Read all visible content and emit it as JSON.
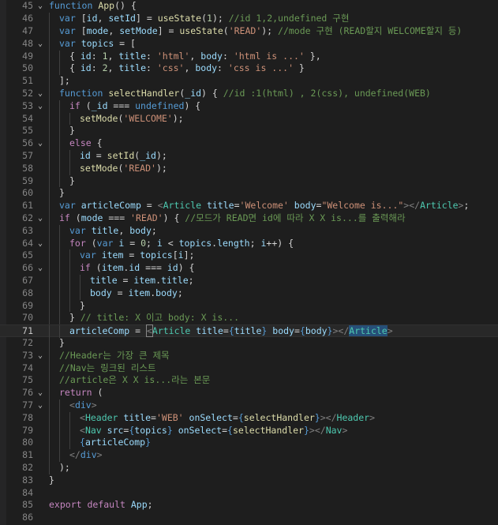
{
  "editor": {
    "lines": [
      {
        "n": "45",
        "fold": "⌄",
        "t": [
          [
            "kw",
            "function "
          ],
          [
            "fn",
            "App"
          ],
          [
            "pu",
            "() {"
          ]
        ]
      },
      {
        "n": "46",
        "t": [
          [
            "kw",
            "var "
          ],
          [
            "pu",
            "["
          ],
          [
            "vr",
            "id"
          ],
          [
            "pu",
            ", "
          ],
          [
            "vr",
            "setId"
          ],
          [
            "pu",
            "] = "
          ],
          [
            "fn",
            "useState"
          ],
          [
            "pu",
            "("
          ],
          [
            "num",
            "1"
          ],
          [
            "pu",
            "); "
          ],
          [
            "cm",
            "//id 1,2,undefined 구현"
          ]
        ]
      },
      {
        "n": "47",
        "t": [
          [
            "kw",
            "var "
          ],
          [
            "pu",
            "["
          ],
          [
            "vr",
            "mode"
          ],
          [
            "pu",
            ", "
          ],
          [
            "vr",
            "setMode"
          ],
          [
            "pu",
            "] = "
          ],
          [
            "fn",
            "useState"
          ],
          [
            "pu",
            "("
          ],
          [
            "str",
            "'READ'"
          ],
          [
            "pu",
            "); "
          ],
          [
            "cm",
            "//mode 구현 (READ할지 WELCOME할지 등)"
          ]
        ]
      },
      {
        "n": "48",
        "fold": "⌄",
        "t": [
          [
            "kw",
            "var "
          ],
          [
            "vr",
            "topics"
          ],
          [
            "pu",
            " = ["
          ]
        ]
      },
      {
        "n": "49",
        "t": [
          [
            "pu",
            "{ "
          ],
          [
            "vr",
            "id"
          ],
          [
            "pu",
            ": "
          ],
          [
            "num",
            "1"
          ],
          [
            "pu",
            ", "
          ],
          [
            "vr",
            "title"
          ],
          [
            "pu",
            ": "
          ],
          [
            "str",
            "'html'"
          ],
          [
            "pu",
            ", "
          ],
          [
            "vr",
            "body"
          ],
          [
            "pu",
            ": "
          ],
          [
            "str",
            "'html is ...'"
          ],
          [
            "pu",
            " },"
          ]
        ]
      },
      {
        "n": "50",
        "t": [
          [
            "pu",
            "{ "
          ],
          [
            "vr",
            "id"
          ],
          [
            "pu",
            ": "
          ],
          [
            "num",
            "2"
          ],
          [
            "pu",
            ", "
          ],
          [
            "vr",
            "title"
          ],
          [
            "pu",
            ": "
          ],
          [
            "str",
            "'css'"
          ],
          [
            "pu",
            ", "
          ],
          [
            "vr",
            "body"
          ],
          [
            "pu",
            ": "
          ],
          [
            "str",
            "'css is ...'"
          ],
          [
            "pu",
            " }"
          ]
        ]
      },
      {
        "n": "51",
        "t": [
          [
            "pu",
            "];"
          ]
        ]
      },
      {
        "n": "52",
        "fold": "⌄",
        "t": [
          [
            "kw",
            "function "
          ],
          [
            "fn",
            "selectHandler"
          ],
          [
            "pu",
            "("
          ],
          [
            "vr",
            "_id"
          ],
          [
            "pu",
            ") { "
          ],
          [
            "cm",
            "//id :1(html) , 2(css), undefined(WEB)"
          ]
        ]
      },
      {
        "n": "53",
        "fold": "⌄",
        "t": [
          [
            "ctl",
            "if "
          ],
          [
            "pu",
            "("
          ],
          [
            "vr",
            "_id"
          ],
          [
            "pu",
            " === "
          ],
          [
            "kw",
            "undefined"
          ],
          [
            "pu",
            ") {"
          ]
        ]
      },
      {
        "n": "54",
        "t": [
          [
            "fn",
            "setMode"
          ],
          [
            "pu",
            "("
          ],
          [
            "str",
            "'WELCOME'"
          ],
          [
            "pu",
            ");"
          ]
        ]
      },
      {
        "n": "55",
        "t": [
          [
            "pu",
            "}"
          ]
        ]
      },
      {
        "n": "56",
        "fold": "⌄",
        "t": [
          [
            "ctl",
            "else "
          ],
          [
            "pu",
            "{"
          ]
        ]
      },
      {
        "n": "57",
        "t": [
          [
            "vr",
            "id"
          ],
          [
            "pu",
            " = "
          ],
          [
            "fn",
            "setId"
          ],
          [
            "pu",
            "("
          ],
          [
            "vr",
            "_id"
          ],
          [
            "pu",
            ");"
          ]
        ]
      },
      {
        "n": "58",
        "t": [
          [
            "fn",
            "setMode"
          ],
          [
            "pu",
            "("
          ],
          [
            "str",
            "'READ'"
          ],
          [
            "pu",
            ");"
          ]
        ]
      },
      {
        "n": "59",
        "t": [
          [
            "pu",
            "}"
          ]
        ]
      },
      {
        "n": "60",
        "t": [
          [
            "pu",
            "}"
          ]
        ]
      },
      {
        "n": "61",
        "t": [
          [
            "kw",
            "var "
          ],
          [
            "vr",
            "articleComp"
          ],
          [
            "pu",
            " = "
          ],
          [
            "br",
            "<"
          ],
          [
            "tag",
            "Article "
          ],
          [
            "attr",
            "title"
          ],
          [
            "pu",
            "="
          ],
          [
            "str",
            "'Welcome' "
          ],
          [
            "attr",
            "body"
          ],
          [
            "pu",
            "="
          ],
          [
            "str",
            "\"Welcome is...\""
          ],
          [
            "br",
            "></"
          ],
          [
            "tag",
            "Article"
          ],
          [
            "br",
            ">"
          ],
          [
            "pu",
            ";"
          ]
        ]
      },
      {
        "n": "62",
        "fold": "⌄",
        "t": [
          [
            "ctl",
            "if "
          ],
          [
            "pu",
            "("
          ],
          [
            "vr",
            "mode"
          ],
          [
            "pu",
            " === "
          ],
          [
            "str",
            "'READ'"
          ],
          [
            "pu",
            ") { "
          ],
          [
            "cm",
            "//모드가 READ면 id에 따라 X X is...를 출력해라"
          ]
        ]
      },
      {
        "n": "63",
        "t": [
          [
            "kw",
            "var "
          ],
          [
            "vr",
            "title"
          ],
          [
            "pu",
            ", "
          ],
          [
            "vr",
            "body"
          ],
          [
            "pu",
            ";"
          ]
        ]
      },
      {
        "n": "64",
        "fold": "⌄",
        "t": [
          [
            "ctl",
            "for "
          ],
          [
            "pu",
            "("
          ],
          [
            "kw",
            "var "
          ],
          [
            "vr",
            "i"
          ],
          [
            "pu",
            " = "
          ],
          [
            "num",
            "0"
          ],
          [
            "pu",
            "; "
          ],
          [
            "vr",
            "i"
          ],
          [
            "pu",
            " < "
          ],
          [
            "vr",
            "topics"
          ],
          [
            "pu",
            "."
          ],
          [
            "vr",
            "length"
          ],
          [
            "pu",
            "; "
          ],
          [
            "vr",
            "i"
          ],
          [
            "pu",
            "++) {"
          ]
        ]
      },
      {
        "n": "65",
        "t": [
          [
            "kw",
            "var "
          ],
          [
            "vr",
            "item"
          ],
          [
            "pu",
            " = "
          ],
          [
            "vr",
            "topics"
          ],
          [
            "pu",
            "["
          ],
          [
            "vr",
            "i"
          ],
          [
            "pu",
            "];"
          ]
        ]
      },
      {
        "n": "66",
        "fold": "⌄",
        "t": [
          [
            "ctl",
            "if "
          ],
          [
            "pu",
            "("
          ],
          [
            "vr",
            "item"
          ],
          [
            "pu",
            "."
          ],
          [
            "vr",
            "id"
          ],
          [
            "pu",
            " === "
          ],
          [
            "vr",
            "id"
          ],
          [
            "pu",
            ") {"
          ]
        ]
      },
      {
        "n": "67",
        "t": [
          [
            "vr",
            "title"
          ],
          [
            "pu",
            " = "
          ],
          [
            "vr",
            "item"
          ],
          [
            "pu",
            "."
          ],
          [
            "vr",
            "title"
          ],
          [
            "pu",
            ";"
          ]
        ]
      },
      {
        "n": "68",
        "t": [
          [
            "vr",
            "body"
          ],
          [
            "pu",
            " = "
          ],
          [
            "vr",
            "item"
          ],
          [
            "pu",
            "."
          ],
          [
            "vr",
            "body"
          ],
          [
            "pu",
            ";"
          ]
        ]
      },
      {
        "n": "69",
        "t": [
          [
            "pu",
            "}"
          ]
        ]
      },
      {
        "n": "70",
        "t": [
          [
            "pu",
            "} "
          ],
          [
            "cm",
            "// title: X 이고 body: X is..."
          ]
        ]
      },
      {
        "n": "71",
        "t": [
          [
            "vr",
            "articleComp"
          ],
          [
            "pu",
            " = "
          ],
          [
            "br",
            "<"
          ],
          [
            "tag",
            "Article"
          ],
          [
            "attr",
            " title"
          ],
          [
            "pu",
            "="
          ],
          [
            "kw",
            "{"
          ],
          [
            "vr",
            "title"
          ],
          [
            "kw",
            "}"
          ],
          [
            "attr",
            " body"
          ],
          [
            "pu",
            "="
          ],
          [
            "kw",
            "{"
          ],
          [
            "vr",
            "body"
          ],
          [
            "kw",
            "}"
          ],
          [
            "br",
            "></"
          ],
          [
            "tag",
            "Article"
          ],
          [
            "br",
            ">"
          ]
        ]
      },
      {
        "n": "72",
        "t": [
          [
            "pu",
            "}"
          ]
        ]
      },
      {
        "n": "73",
        "fold": "⌄",
        "t": [
          [
            "cm",
            "//Header는 가장 큰 제목"
          ]
        ]
      },
      {
        "n": "74",
        "t": [
          [
            "cm",
            "//Nav는 링크된 리스트"
          ]
        ]
      },
      {
        "n": "75",
        "t": [
          [
            "cm",
            "//article은 X X is...라는 본문"
          ]
        ]
      },
      {
        "n": "76",
        "fold": "⌄",
        "t": [
          [
            "ctl",
            "return "
          ],
          [
            "pu",
            "("
          ]
        ]
      },
      {
        "n": "77",
        "fold": "⌄",
        "t": [
          [
            "br",
            "<"
          ],
          [
            "kw",
            "div"
          ],
          [
            "br",
            ">"
          ]
        ]
      },
      {
        "n": "78",
        "t": [
          [
            "br",
            "<"
          ],
          [
            "tag",
            "Header "
          ],
          [
            "attr",
            "title"
          ],
          [
            "pu",
            "="
          ],
          [
            "str",
            "'WEB' "
          ],
          [
            "attr",
            "onSelect"
          ],
          [
            "pu",
            "="
          ],
          [
            "kw",
            "{"
          ],
          [
            "fn",
            "selectHandler"
          ],
          [
            "kw",
            "}"
          ],
          [
            "br",
            "></"
          ],
          [
            "tag",
            "Header"
          ],
          [
            "br",
            ">"
          ]
        ]
      },
      {
        "n": "79",
        "t": [
          [
            "br",
            "<"
          ],
          [
            "tag",
            "Nav "
          ],
          [
            "attr",
            "src"
          ],
          [
            "pu",
            "="
          ],
          [
            "kw",
            "{"
          ],
          [
            "vr",
            "topics"
          ],
          [
            "kw",
            "} "
          ],
          [
            "attr",
            "onSelect"
          ],
          [
            "pu",
            "="
          ],
          [
            "kw",
            "{"
          ],
          [
            "fn",
            "selectHandler"
          ],
          [
            "kw",
            "}"
          ],
          [
            "br",
            "></"
          ],
          [
            "tag",
            "Nav"
          ],
          [
            "br",
            ">"
          ]
        ]
      },
      {
        "n": "80",
        "t": [
          [
            "kw",
            "{"
          ],
          [
            "vr",
            "articleComp"
          ],
          [
            "kw",
            "}"
          ]
        ]
      },
      {
        "n": "81",
        "t": [
          [
            "br",
            "</"
          ],
          [
            "kw",
            "div"
          ],
          [
            "br",
            ">"
          ]
        ]
      },
      {
        "n": "82",
        "t": [
          [
            "pu",
            ");"
          ]
        ]
      },
      {
        "n": "83",
        "t": [
          [
            "pu",
            "}"
          ]
        ]
      },
      {
        "n": "84",
        "t": []
      },
      {
        "n": "85",
        "t": [
          [
            "ctl",
            "export "
          ],
          [
            "ctl",
            "default "
          ],
          [
            "vr",
            "App"
          ],
          [
            "pu",
            ";"
          ]
        ]
      },
      {
        "n": "86",
        "t": []
      }
    ]
  }
}
